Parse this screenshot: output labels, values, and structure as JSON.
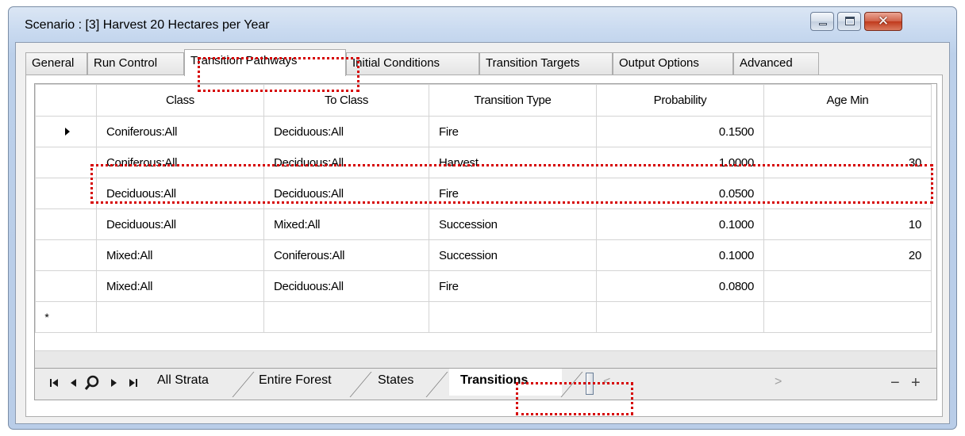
{
  "window": {
    "title": "Scenario : [3] Harvest 20 Hectares per Year",
    "minimize_icon": "minimize-icon",
    "maximize_icon": "maximize-icon",
    "close_icon": "close-icon",
    "close_glyph": "✕"
  },
  "tabs": [
    {
      "label": "General"
    },
    {
      "label": "Run Control"
    },
    {
      "label": "Transition Pathways",
      "active": true
    },
    {
      "label": "Initial Conditions"
    },
    {
      "label": "Transition Targets"
    },
    {
      "label": "Output Options"
    },
    {
      "label": "Advanced"
    }
  ],
  "grid": {
    "columns": [
      "Class",
      "To Class",
      "Transition Type",
      "Probability",
      "Age Min"
    ],
    "rows": [
      {
        "class": "Coniferous:All",
        "to_class": "Deciduous:All",
        "type": "Fire",
        "probability": "0.1500",
        "age_min": ""
      },
      {
        "class": "Coniferous:All",
        "to_class": "Deciduous:All",
        "type": "Harvest",
        "probability": "1.0000",
        "age_min": "30"
      },
      {
        "class": "Deciduous:All",
        "to_class": "Deciduous:All",
        "type": "Fire",
        "probability": "0.0500",
        "age_min": ""
      },
      {
        "class": "Deciduous:All",
        "to_class": "Mixed:All",
        "type": "Succession",
        "probability": "0.1000",
        "age_min": "10"
      },
      {
        "class": "Mixed:All",
        "to_class": "Coniferous:All",
        "type": "Succession",
        "probability": "0.1000",
        "age_min": "20"
      },
      {
        "class": "Mixed:All",
        "to_class": "Deciduous:All",
        "type": "Fire",
        "probability": "0.0800",
        "age_min": ""
      }
    ],
    "current_row_marker": "▶",
    "new_row_marker": "*"
  },
  "footer": {
    "nav": {
      "first": "⏮",
      "prev": "◀",
      "search": "search-icon",
      "next": "▶",
      "last": "⏭"
    },
    "sheets": [
      {
        "label": "All Strata"
      },
      {
        "label": "Entire Forest"
      },
      {
        "label": "States"
      },
      {
        "label": "Transitions",
        "active": true
      }
    ],
    "scroll_left": "<",
    "scroll_right": ">",
    "minus": "−",
    "plus": "+"
  }
}
